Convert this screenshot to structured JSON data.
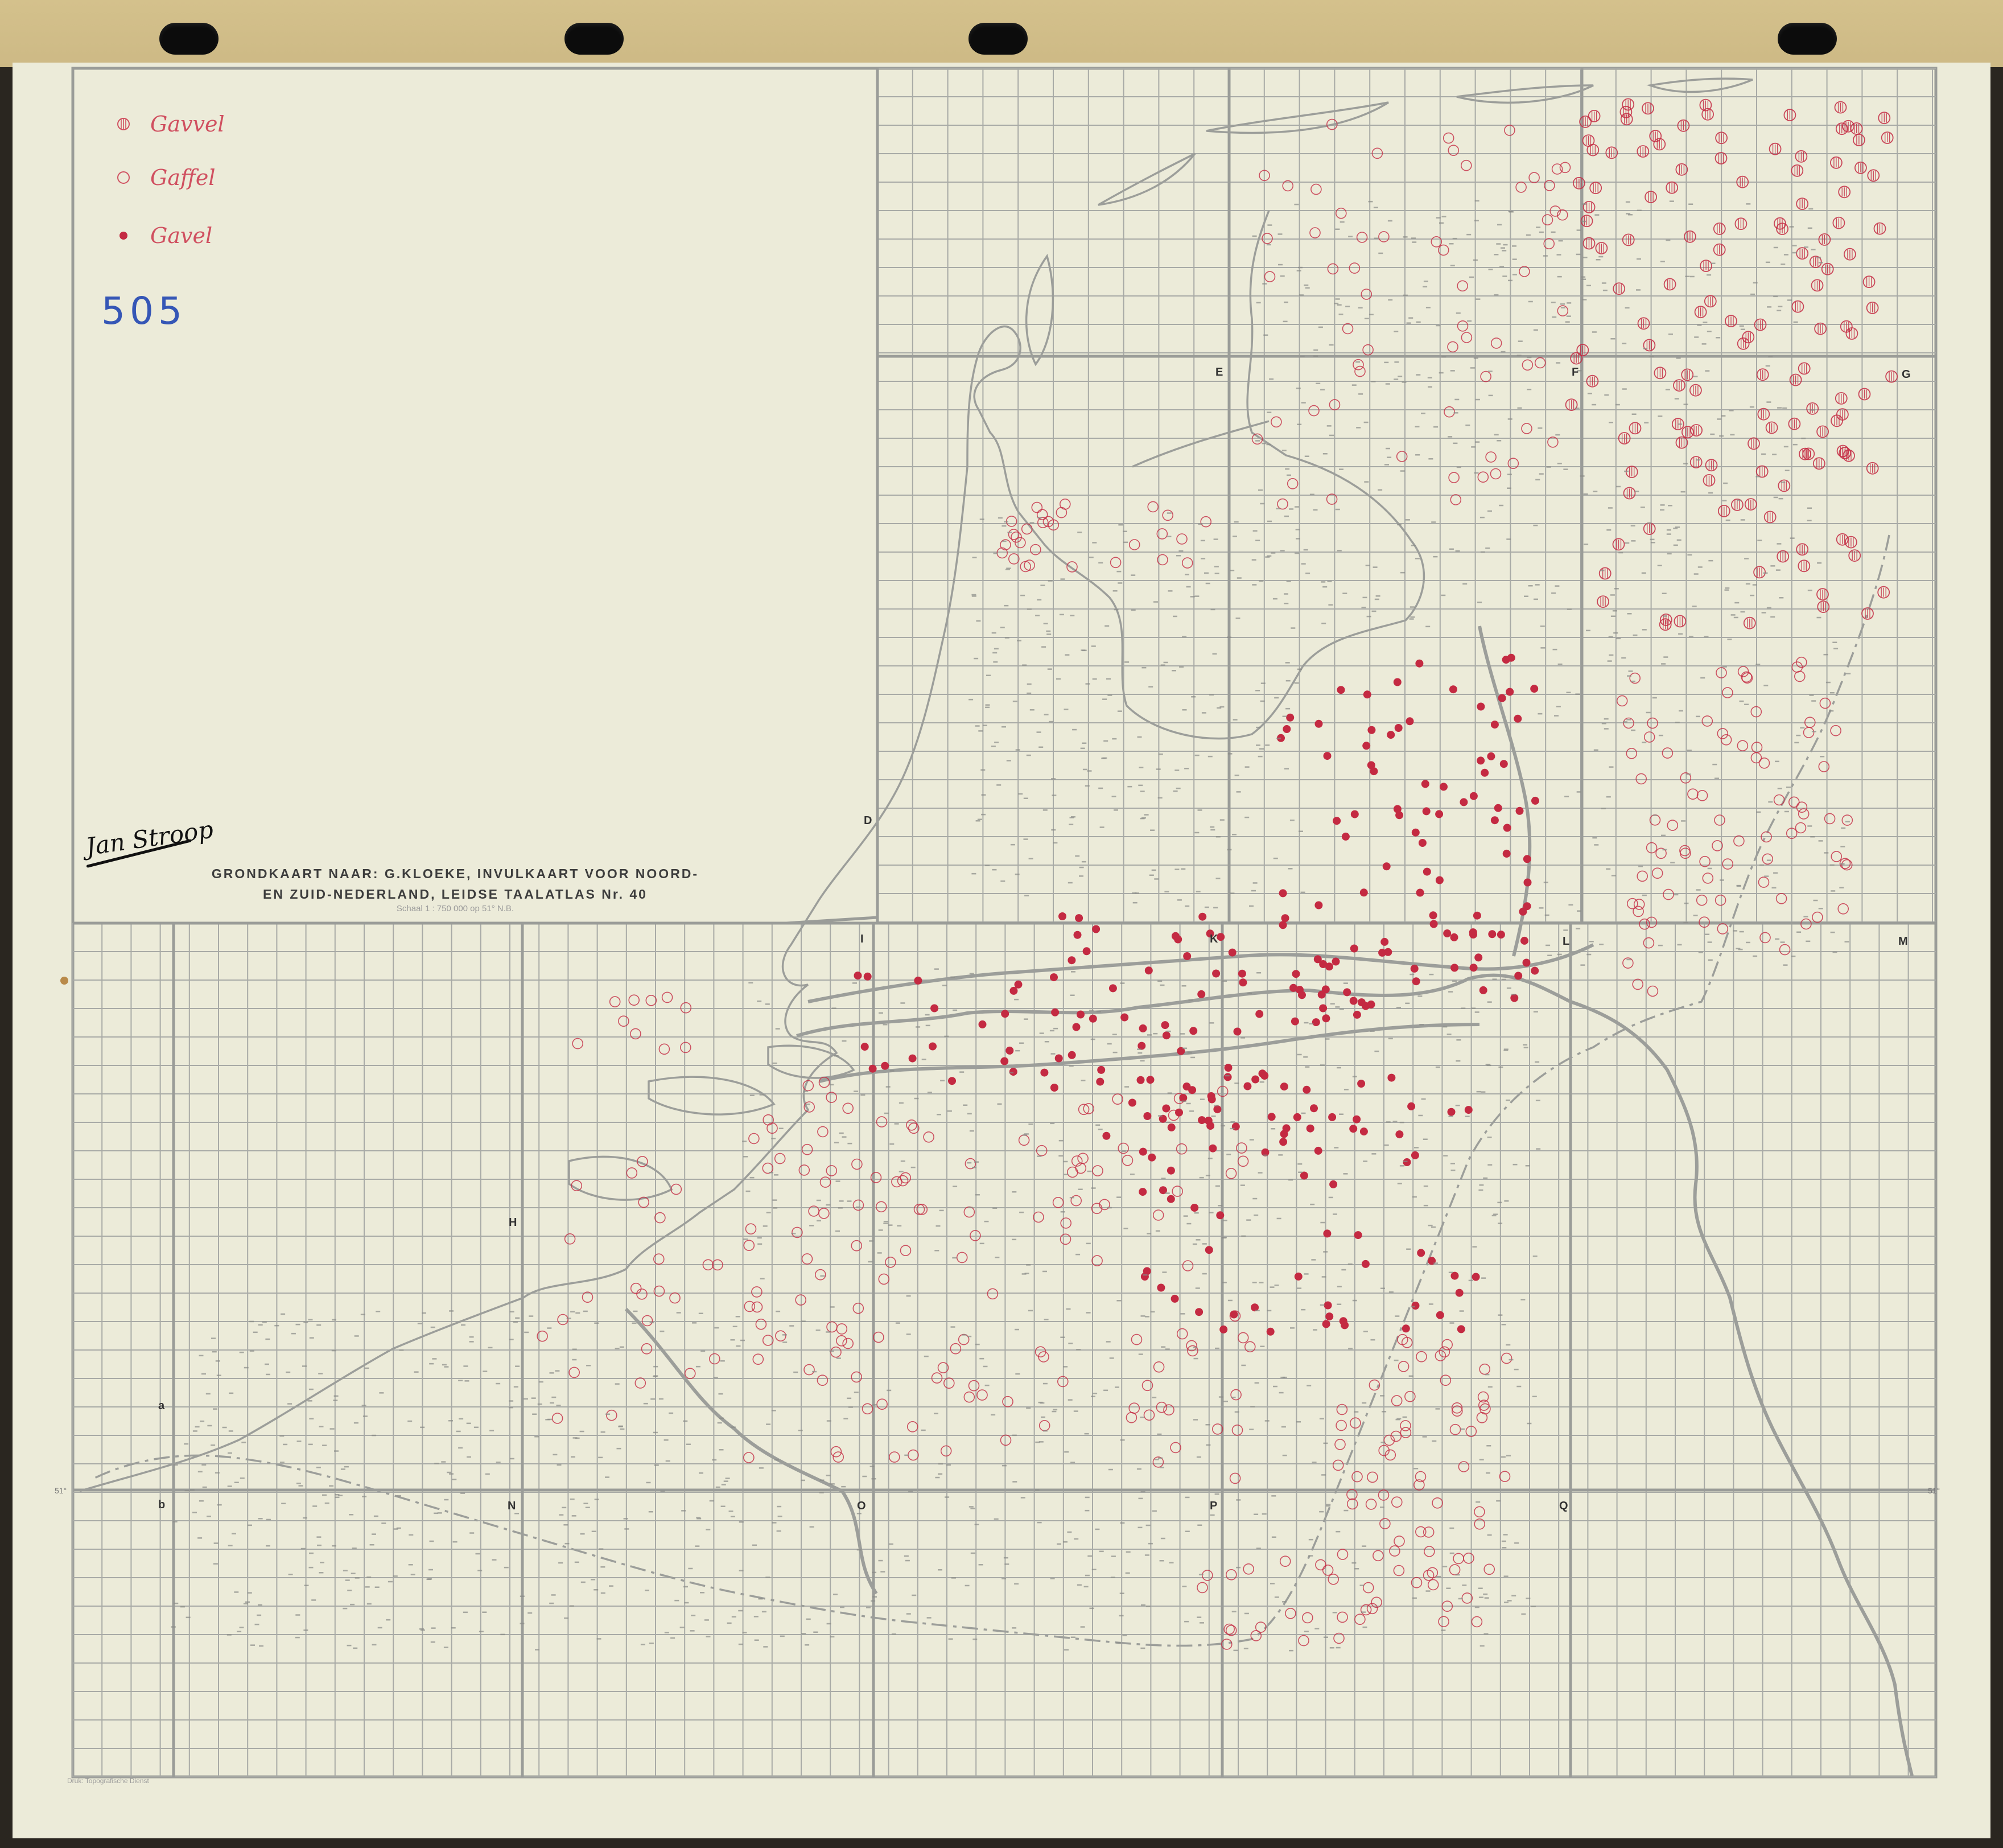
{
  "legend": {
    "items": [
      {
        "symbol": "hatched-circle",
        "label": "Gavvel"
      },
      {
        "symbol": "open-circle",
        "label": "Gaffel"
      },
      {
        "symbol": "solid-dot",
        "label": "Gavel"
      }
    ]
  },
  "map_number": "505",
  "signature": "Jan Stroop",
  "title_lines": [
    "GRONDKAART NAAR: G.KLOEKE, INVULKAART VOOR NOORD-",
    "EN ZUID-NEDERLAND, LEIDSE TAALATLAS Nr. 40"
  ],
  "scale": "Schaal 1 : 750 000 op 51° N.B.",
  "printer_note": "Druk: Topografische Dienst",
  "latitude_label": "51°",
  "grid_letters": [
    "E",
    "F",
    "G",
    "D",
    "I",
    "K",
    "L",
    "M",
    "H",
    "a",
    "b",
    "N",
    "O",
    "P",
    "Q"
  ],
  "colors": {
    "paper": "#ecebd9",
    "grid": "#a8aaa6",
    "border": "#9a9c98",
    "symbol_red": "#c42a42",
    "legend_red": "#d05060",
    "number_blue": "#3556b6",
    "tape": "#d4c18c"
  }
}
